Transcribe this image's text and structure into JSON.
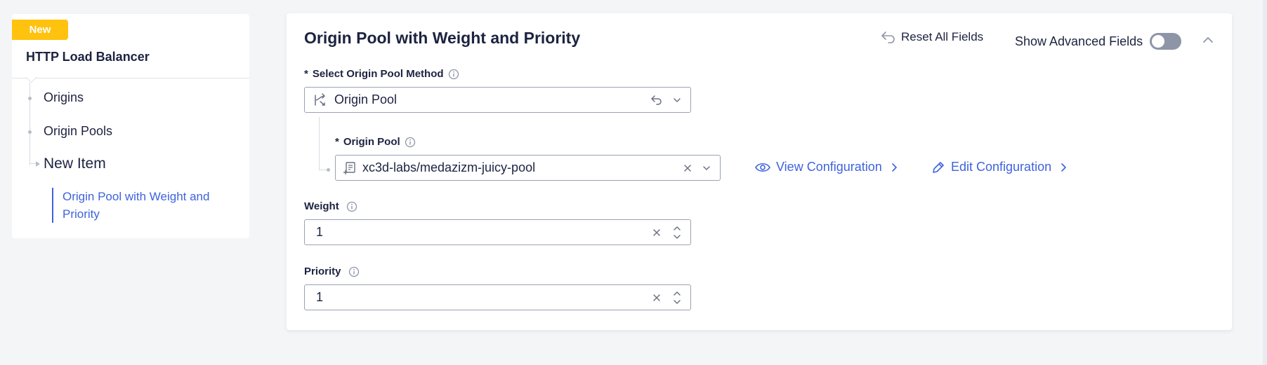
{
  "nav": {
    "badge": "New",
    "title": "HTTP Load Balancer",
    "items": [
      {
        "label": "Origins"
      },
      {
        "label": "Origin Pools"
      },
      {
        "label": "New Item"
      }
    ],
    "sub_item": "Origin Pool with Weight and Priority"
  },
  "card": {
    "title": "Origin Pool with Weight and Priority",
    "reset_label": "Reset All Fields",
    "advanced_label": "Show Advanced Fields",
    "advanced_enabled": false
  },
  "fields": {
    "method": {
      "required": "*",
      "label": "Select Origin Pool Method",
      "value": "Origin Pool"
    },
    "origin_pool": {
      "required": "*",
      "label": "Origin Pool",
      "value": "xc3d-labs/medazizm-juicy-pool",
      "view_label": "View Configuration",
      "edit_label": "Edit Configuration"
    },
    "weight": {
      "label": "Weight",
      "value": "1"
    },
    "priority": {
      "label": "Priority",
      "value": "1"
    }
  },
  "colors": {
    "accent": "#3e63dd",
    "badge": "#ffc20e",
    "text": "#1c2340",
    "toggle_off": "#8e95a7"
  },
  "icons": {
    "reset": "reset-arrow-icon",
    "collapse": "chevron-up-icon",
    "info": "info-icon",
    "method": "split-route-icon",
    "pool": "document-plus-icon",
    "view": "eye-icon",
    "edit": "pencil-icon"
  }
}
